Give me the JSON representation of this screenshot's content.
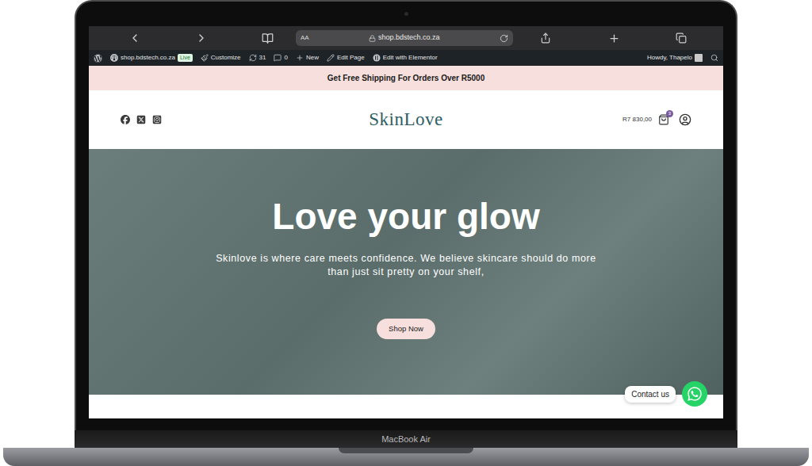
{
  "browser": {
    "reader": "AA",
    "address": "shop.bdstech.co.za"
  },
  "admin_bar": {
    "site": "shop.bdstech.co.za",
    "badge": "Live",
    "items": [
      {
        "label": "Customize",
        "kind": "customize"
      },
      {
        "label": "31",
        "kind": "updates"
      },
      {
        "label": "0",
        "kind": "comments"
      },
      {
        "label": "New",
        "kind": "new"
      },
      {
        "label": "Edit Page",
        "kind": "edit"
      },
      {
        "label": "Edit with Elementor",
        "kind": "elementor"
      }
    ],
    "greeting": "Howdy, Thapelo"
  },
  "announcement": "Get Free Shipping For Orders Over R5000",
  "header": {
    "logo": "SkinLove",
    "cart_total": "R7 830,00",
    "cart_count": "3"
  },
  "hero": {
    "title": "Love your glow",
    "text": "Skinlove is where care meets confidence. We believe skincare should do more than just sit pretty on your shelf,",
    "button": "Shop Now"
  },
  "chat": {
    "label": "Contact us"
  },
  "device": {
    "label": "MacBook Air"
  }
}
